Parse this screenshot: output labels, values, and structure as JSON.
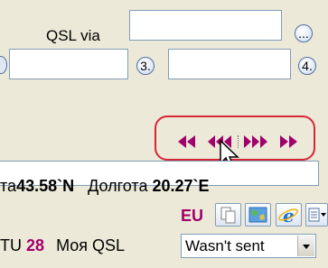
{
  "qsl_via": {
    "label": "QSL via",
    "value": "",
    "browse_button": "..."
  },
  "via_fields": [
    {
      "value": "",
      "button_label": "3."
    },
    {
      "value": "",
      "button_label": "4."
    }
  ],
  "navigation": {
    "first_icon": "double-left-arrow-icon",
    "prev_icon": "triple-left-arrow-icon",
    "next_icon": "triple-right-arrow-icon",
    "last_icon": "double-right-arrow-icon",
    "accent_color": "#a0006c",
    "highlight_color": "#d62735"
  },
  "location": {
    "lat_label_fragment": "та",
    "latitude": "43.58`N",
    "lon_label": "Долгота",
    "longitude": "20.27`E"
  },
  "continent": {
    "value": "EU",
    "color": "#a0006c"
  },
  "toolbar": {
    "buttons": [
      "copy-icon",
      "map-icon",
      "internet-explorer-icon",
      "list-dropdown-icon"
    ]
  },
  "itu": {
    "label_fragment": "TU",
    "value": "28",
    "color": "#a0006c"
  },
  "my_qsl": {
    "label": "Моя QSL",
    "selected": "Wasn't sent"
  }
}
